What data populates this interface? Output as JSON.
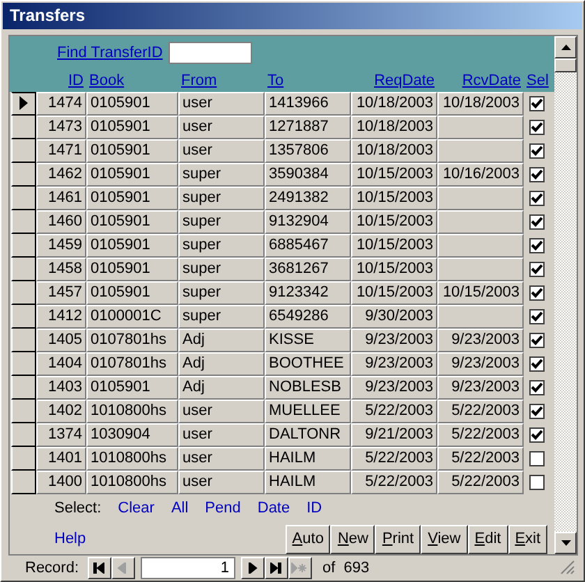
{
  "window": {
    "title": "Transfers"
  },
  "find": {
    "label": "Find TransferID"
  },
  "columns": [
    "ID",
    "Book",
    "From",
    "To",
    "ReqDate",
    "RcvDate",
    "Sel"
  ],
  "rows": [
    {
      "current": true,
      "id": "1474",
      "book": "0105901",
      "from": "user",
      "to": "1413966",
      "req": "10/18/2003",
      "rcv": "10/18/2003",
      "sel": true
    },
    {
      "current": false,
      "id": "1473",
      "book": "0105901",
      "from": "user",
      "to": "1271887",
      "req": "10/18/2003",
      "rcv": "",
      "sel": true
    },
    {
      "current": false,
      "id": "1471",
      "book": "0105901",
      "from": "user",
      "to": "1357806",
      "req": "10/18/2003",
      "rcv": "",
      "sel": true
    },
    {
      "current": false,
      "id": "1462",
      "book": "0105901",
      "from": "super",
      "to": "3590384",
      "req": "10/15/2003",
      "rcv": "10/16/2003",
      "sel": true
    },
    {
      "current": false,
      "id": "1461",
      "book": "0105901",
      "from": "super",
      "to": "2491382",
      "req": "10/15/2003",
      "rcv": "",
      "sel": true
    },
    {
      "current": false,
      "id": "1460",
      "book": "0105901",
      "from": "super",
      "to": "9132904",
      "req": "10/15/2003",
      "rcv": "",
      "sel": true
    },
    {
      "current": false,
      "id": "1459",
      "book": "0105901",
      "from": "super",
      "to": "6885467",
      "req": "10/15/2003",
      "rcv": "",
      "sel": true
    },
    {
      "current": false,
      "id": "1458",
      "book": "0105901",
      "from": "super",
      "to": "3681267",
      "req": "10/15/2003",
      "rcv": "",
      "sel": true
    },
    {
      "current": false,
      "id": "1457",
      "book": "0105901",
      "from": "super",
      "to": "9123342",
      "req": "10/15/2003",
      "rcv": "10/15/2003",
      "sel": true
    },
    {
      "current": false,
      "id": "1412",
      "book": "0100001C",
      "from": "super",
      "to": "6549286",
      "req": "9/30/2003",
      "rcv": "",
      "sel": true
    },
    {
      "current": false,
      "id": "1405",
      "book": "0107801hs",
      "from": "Adj",
      "to": "KISSE",
      "req": "9/23/2003",
      "rcv": "9/23/2003",
      "sel": true
    },
    {
      "current": false,
      "id": "1404",
      "book": "0107801hs",
      "from": "Adj",
      "to": "BOOTHEE",
      "req": "9/23/2003",
      "rcv": "9/23/2003",
      "sel": true
    },
    {
      "current": false,
      "id": "1403",
      "book": "0105901",
      "from": "Adj",
      "to": "NOBLESB",
      "req": "9/23/2003",
      "rcv": "9/23/2003",
      "sel": true
    },
    {
      "current": false,
      "id": "1402",
      "book": "1010800hs",
      "from": "user",
      "to": "MUELLEE",
      "req": "5/22/2003",
      "rcv": "5/22/2003",
      "sel": true
    },
    {
      "current": false,
      "id": "1374",
      "book": "1030904",
      "from": "user",
      "to": "DALTONR",
      "req": "9/21/2003",
      "rcv": "5/22/2003",
      "sel": true
    },
    {
      "current": false,
      "id": "1401",
      "book": "1010800hs",
      "from": "user",
      "to": "HAILM",
      "req": "5/22/2003",
      "rcv": "5/22/2003",
      "sel": false
    },
    {
      "current": false,
      "id": "1400",
      "book": "1010800hs",
      "from": "user",
      "to": "HAILM",
      "req": "5/22/2003",
      "rcv": "5/22/2003",
      "sel": false
    }
  ],
  "select": {
    "label": "Select:",
    "links": [
      "Clear",
      "All",
      "Pend",
      "Date",
      "ID"
    ]
  },
  "help": "Help",
  "buttons": [
    "Auto",
    "New",
    "Print",
    "View",
    "Edit",
    "Exit"
  ],
  "navigator": {
    "label": "Record:",
    "current": "1",
    "of": "of",
    "total": "693",
    "buttons": [
      {
        "kind": "first",
        "disabled": false
      },
      {
        "kind": "prev",
        "disabled": true
      },
      {
        "kind": "next",
        "disabled": false
      },
      {
        "kind": "last",
        "disabled": false
      },
      {
        "kind": "new",
        "disabled": true
      }
    ]
  }
}
